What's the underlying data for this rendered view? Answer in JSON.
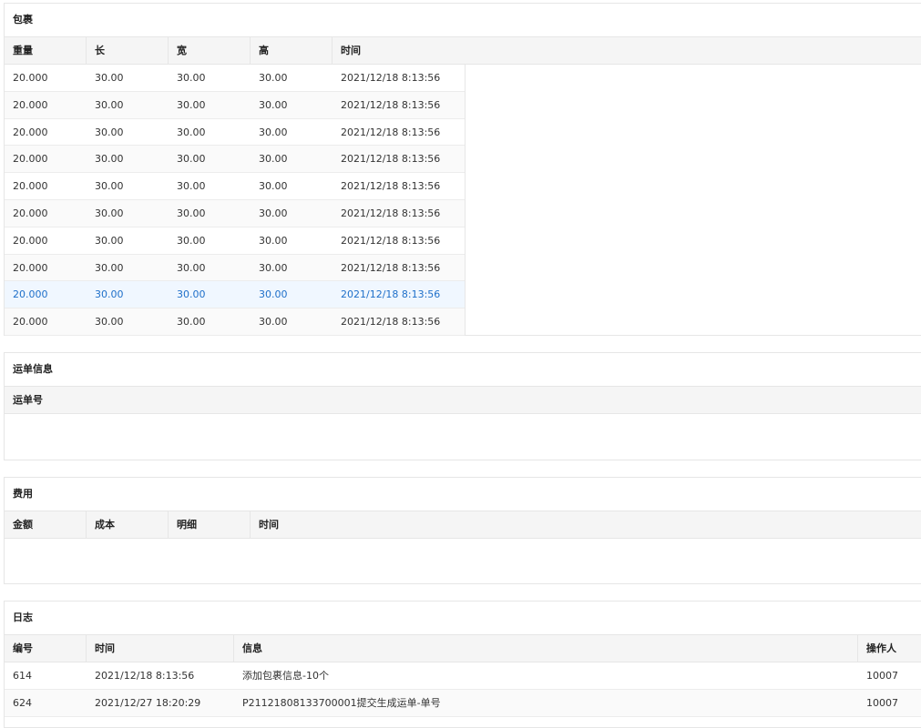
{
  "packages": {
    "title": "包裹",
    "columns": [
      "重量",
      "长",
      "宽",
      "高",
      "时间"
    ],
    "rows": [
      [
        "20.000",
        "30.00",
        "30.00",
        "30.00",
        "2021/12/18 8:13:56"
      ],
      [
        "20.000",
        "30.00",
        "30.00",
        "30.00",
        "2021/12/18 8:13:56"
      ],
      [
        "20.000",
        "30.00",
        "30.00",
        "30.00",
        "2021/12/18 8:13:56"
      ],
      [
        "20.000",
        "30.00",
        "30.00",
        "30.00",
        "2021/12/18 8:13:56"
      ],
      [
        "20.000",
        "30.00",
        "30.00",
        "30.00",
        "2021/12/18 8:13:56"
      ],
      [
        "20.000",
        "30.00",
        "30.00",
        "30.00",
        "2021/12/18 8:13:56"
      ],
      [
        "20.000",
        "30.00",
        "30.00",
        "30.00",
        "2021/12/18 8:13:56"
      ],
      [
        "20.000",
        "30.00",
        "30.00",
        "30.00",
        "2021/12/18 8:13:56"
      ],
      [
        "20.000",
        "30.00",
        "30.00",
        "30.00",
        "2021/12/18 8:13:56"
      ],
      [
        "20.000",
        "30.00",
        "30.00",
        "30.00",
        "2021/12/18 8:13:56"
      ]
    ]
  },
  "waybill": {
    "title": "运单信息",
    "columns": [
      "运单号"
    ]
  },
  "fees": {
    "title": "费用",
    "columns": [
      "金额",
      "成本",
      "明细",
      "时间"
    ]
  },
  "log": {
    "title": "日志",
    "columns": [
      "编号",
      "时间",
      "信息",
      "操作人"
    ],
    "rows": [
      [
        "614",
        "2021/12/18 8:13:56",
        "添加包裹信息-10个",
        "10007"
      ],
      [
        "624",
        "2021/12/27 18:20:29",
        "P21121808133700001提交生成运单-单号",
        "10007"
      ]
    ]
  },
  "colors": {
    "header_bg": "#f5f5f5",
    "border": "#e6e6e6",
    "hover_text": "#1e6fc9",
    "hover_bg": "#f0f7ff"
  }
}
